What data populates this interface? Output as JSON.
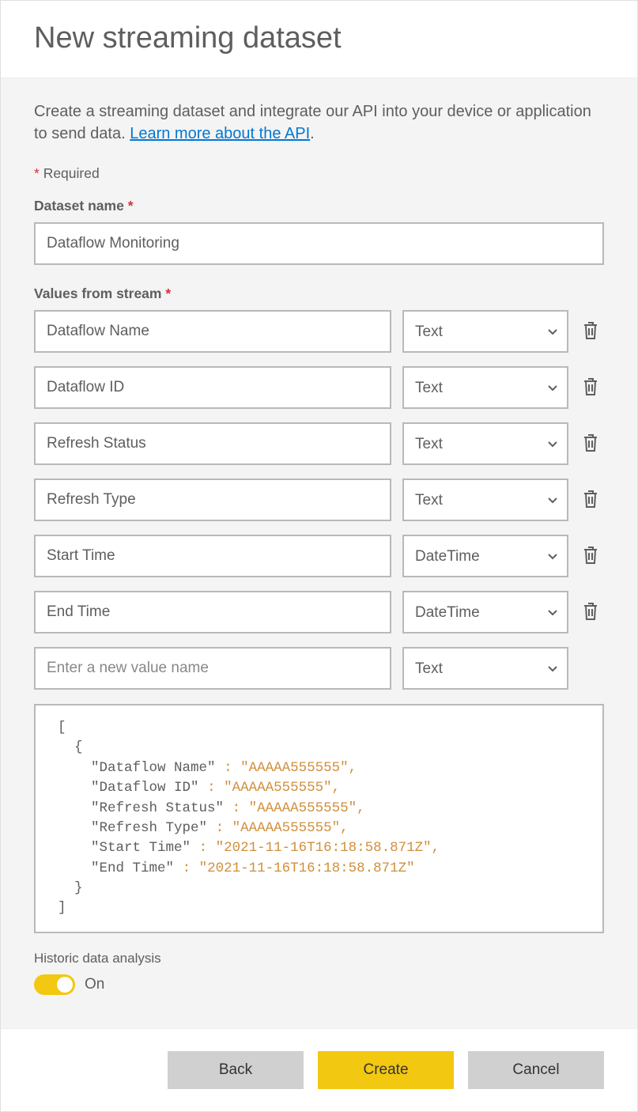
{
  "header": {
    "title": "New streaming dataset"
  },
  "intro": {
    "text_before": "Create a streaming dataset and integrate our API into your device or application to send data. ",
    "link_text": "Learn more about the API",
    "text_after": "."
  },
  "required_note": "Required",
  "dataset_name": {
    "label": "Dataset name",
    "value": "Dataflow Monitoring"
  },
  "values_from_stream": {
    "label": "Values from stream",
    "rows": [
      {
        "name": "Dataflow Name",
        "type": "Text"
      },
      {
        "name": "Dataflow ID",
        "type": "Text"
      },
      {
        "name": "Refresh Status",
        "type": "Text"
      },
      {
        "name": "Refresh Type",
        "type": "Text"
      },
      {
        "name": "Start Time",
        "type": "DateTime"
      },
      {
        "name": "End Time",
        "type": "DateTime"
      }
    ],
    "new_row": {
      "placeholder": "Enter a new value name",
      "type": "Text"
    }
  },
  "json_sample": {
    "lines": [
      {
        "indent": 0,
        "text": "[",
        "cls": "bracket"
      },
      {
        "indent": 1,
        "text": "{",
        "cls": "bracket"
      },
      {
        "indent": 2,
        "key": "Dataflow Name",
        "value": "AAAAA555555",
        "trailing_comma": true
      },
      {
        "indent": 2,
        "key": "Dataflow ID",
        "value": "AAAAA555555",
        "trailing_comma": true
      },
      {
        "indent": 2,
        "key": "Refresh Status",
        "value": "AAAAA555555",
        "trailing_comma": true
      },
      {
        "indent": 2,
        "key": "Refresh Type",
        "value": "AAAAA555555",
        "trailing_comma": true
      },
      {
        "indent": 2,
        "key": "Start Time",
        "value": "2021-11-16T16:18:58.871Z",
        "trailing_comma": true
      },
      {
        "indent": 2,
        "key": "End Time",
        "value": "2021-11-16T16:18:58.871Z",
        "trailing_comma": false
      },
      {
        "indent": 1,
        "text": "}",
        "cls": "bracket"
      },
      {
        "indent": 0,
        "text": "]",
        "cls": "bracket"
      }
    ]
  },
  "historic": {
    "label": "Historic data analysis",
    "state": "On",
    "on": true
  },
  "footer": {
    "back": "Back",
    "create": "Create",
    "cancel": "Cancel"
  }
}
